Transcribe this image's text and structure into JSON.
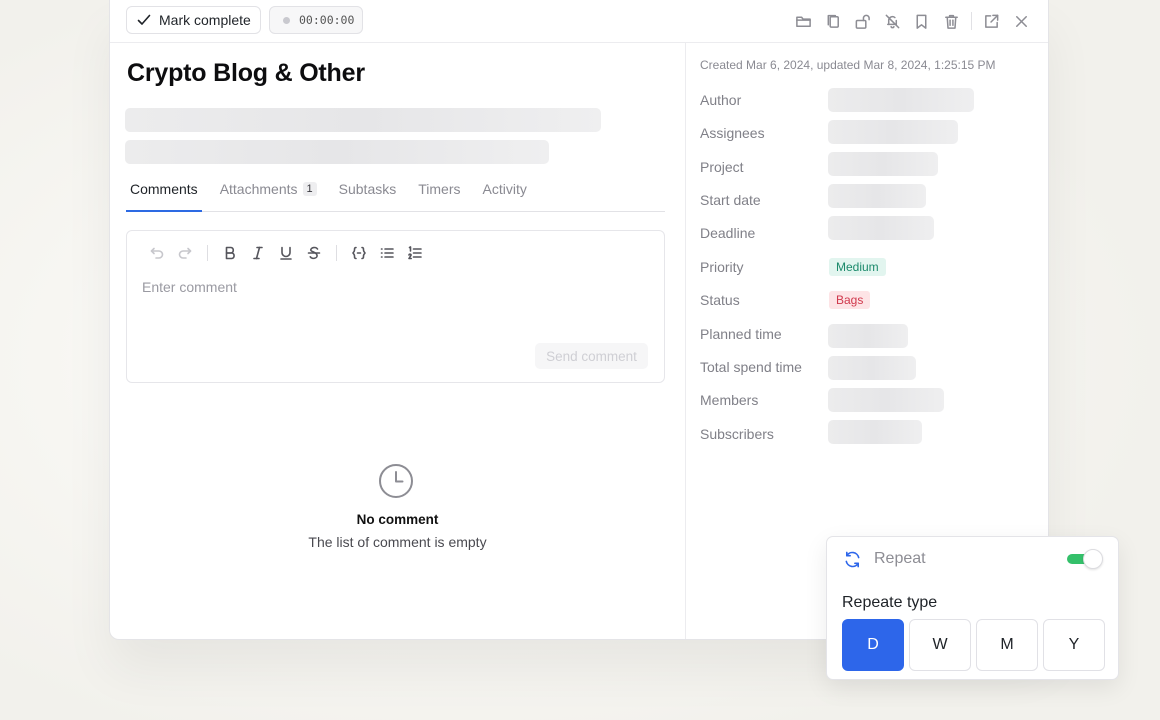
{
  "topbar": {
    "mark_complete_label": "Mark complete",
    "timer_value": "00:00:00"
  },
  "task": {
    "title": "Crypto Blog & Other"
  },
  "tabs": [
    {
      "label": "Comments",
      "active": true
    },
    {
      "label": "Attachments",
      "badge": "1"
    },
    {
      "label": "Subtasks"
    },
    {
      "label": "Timers"
    },
    {
      "label": "Activity"
    }
  ],
  "comment_editor": {
    "placeholder": "Enter comment",
    "send_label": "Send comment"
  },
  "empty_state": {
    "title": "No comment",
    "subtitle": "The list of comment is empty"
  },
  "details": {
    "created_text": "Created Mar 6, 2024, updated Mar 8, 2024, 1:25:15 PM",
    "properties": [
      {
        "label": "Author"
      },
      {
        "label": "Assignees"
      },
      {
        "label": "Project"
      },
      {
        "label": "Start date"
      },
      {
        "label": "Deadline"
      },
      {
        "label": "Priority",
        "value": "Medium"
      },
      {
        "label": "Status",
        "value": "Bags"
      },
      {
        "label": "Planned time"
      },
      {
        "label": "Total spend time"
      },
      {
        "label": "Members"
      },
      {
        "label": "Subscribers"
      }
    ]
  },
  "repeat": {
    "label": "Repeat",
    "enabled": true,
    "type_label": "Repeate type",
    "options": [
      "D",
      "W",
      "M",
      "Y"
    ],
    "selected": "D"
  },
  "colors": {
    "accent": "#2d66ea",
    "toggle_on": "#34c06a",
    "priority_bg": "#e2f5ef",
    "priority_text": "#1b8a6b",
    "status_bg": "#fde4e6",
    "status_text": "#d0394d"
  }
}
